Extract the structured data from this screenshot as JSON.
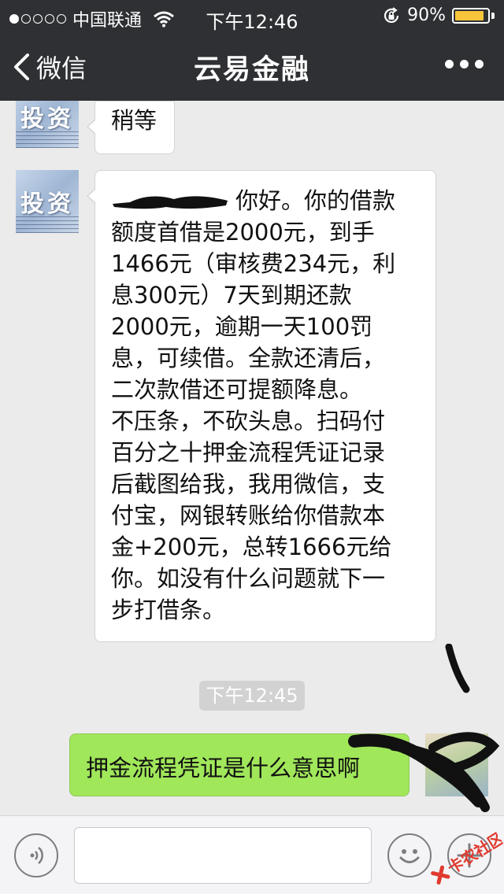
{
  "status_bar": {
    "carrier": "中国联通",
    "time": "下午12:46",
    "battery": "90%",
    "battery_level": 0.9,
    "battery_color": "#f7c53c"
  },
  "nav": {
    "back_label": "微信",
    "title": "云易金融",
    "more_icon": "more-dots-icon"
  },
  "messages": [
    {
      "side": "left",
      "avatar_text": "投资",
      "text": "稍等"
    },
    {
      "side": "left",
      "avatar_text": "投资",
      "lines": [
        "你好。你的借款",
        "额度首借是2000元，到手",
        "1466元（审核费234元，利",
        "息300元）7天到期还款",
        "2000元，逾期一天100罚",
        "息，可续借。全款还清后，",
        "二次款借还可提额降息。",
        "不压条，不砍头息。扫码付",
        "百分之十押金流程凭证记录",
        "后截图给我，我用微信，支",
        "付宝，网银转账给你借款本",
        "金+200元，总转1666元给",
        "你。如没有什么问题就下一",
        "步打借条。"
      ]
    },
    {
      "type": "timestamp",
      "text": "下午12:45"
    },
    {
      "side": "right",
      "text": "押金流程凭证是什么意思啊"
    }
  ],
  "input_bar": {
    "voice_icon": "voice-icon",
    "emoji_icon": "emoji-icon",
    "plus_icon": "plus-icon"
  },
  "watermark": {
    "text": "卡农社区"
  },
  "colors": {
    "header_bg": "#2e3033",
    "chat_bg": "#ebebeb",
    "sent_bubble": "#a0e75a",
    "received_bubble": "#ffffff"
  }
}
